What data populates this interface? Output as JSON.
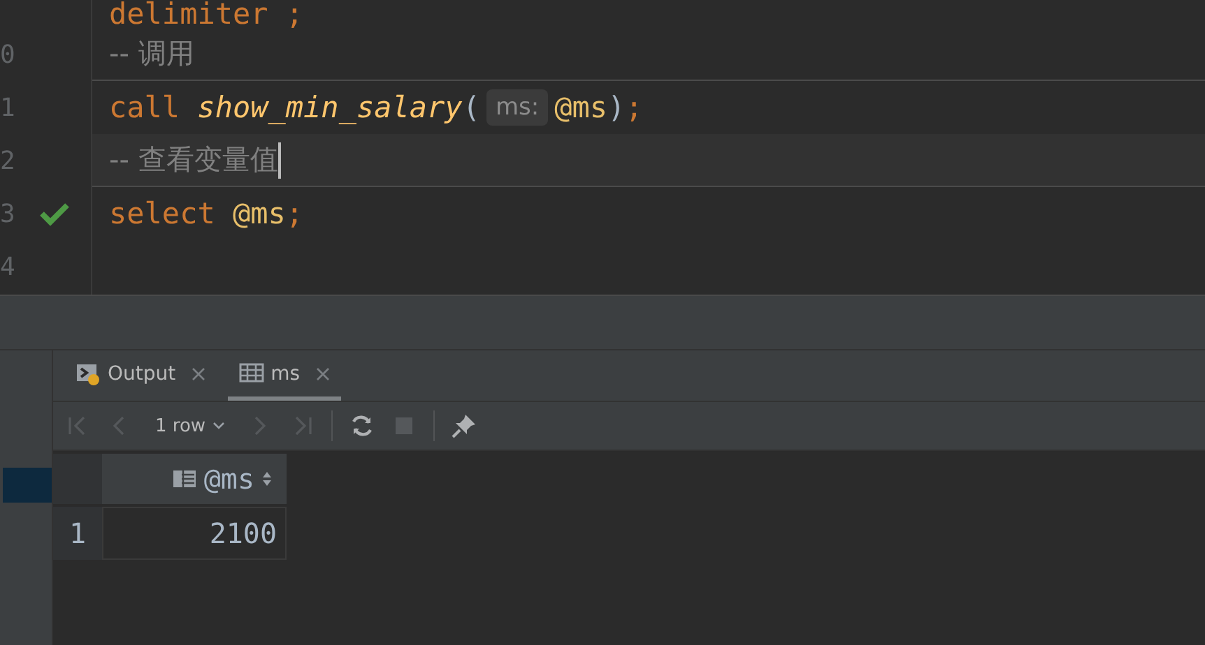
{
  "editor": {
    "lines": [
      {
        "tokens": [
          {
            "kind": "keyword",
            "text": "delimiter ;"
          }
        ]
      },
      {
        "gutter": "0",
        "separator_below": true,
        "tokens": [
          {
            "kind": "comment",
            "text": "-- 调用"
          }
        ]
      },
      {
        "gutter": "1",
        "tokens": [
          {
            "kind": "keyword",
            "text": "call"
          },
          {
            "kind": "function",
            "text": "show_min_salary"
          },
          {
            "kind": "paren",
            "text": "("
          },
          {
            "kind": "hint",
            "text": "ms:"
          },
          {
            "kind": "variable",
            "text": "@ms"
          },
          {
            "kind": "paren",
            "text": ")"
          },
          {
            "kind": "semicolon",
            "text": ";"
          }
        ]
      },
      {
        "gutter": "2",
        "current": true,
        "separator_below": true,
        "tokens": [
          {
            "kind": "comment",
            "text": "-- 查看变量值"
          }
        ]
      },
      {
        "gutter": "3",
        "passed": true,
        "tokens": [
          {
            "kind": "keyword",
            "text": "select"
          },
          {
            "kind": "variable",
            "text": "@ms"
          },
          {
            "kind": "semicolon",
            "text": ";"
          }
        ]
      },
      {
        "gutter": "4"
      }
    ]
  },
  "left_panel": {
    "rows": [
      {
        "selected": true
      }
    ]
  },
  "results": {
    "tabs": [
      {
        "kind": "output",
        "label": "Output",
        "selected": false
      },
      {
        "kind": "table",
        "label": "ms",
        "selected": true
      }
    ],
    "toolbar": [
      {
        "kind": "first",
        "disabled": true
      },
      {
        "kind": "prev",
        "disabled": true
      },
      {
        "kind": "pagesize",
        "label": "1 row"
      },
      {
        "kind": "next",
        "disabled": true
      },
      {
        "kind": "last",
        "disabled": true
      },
      {
        "kind": "separator"
      },
      {
        "kind": "refresh",
        "disabled": false
      },
      {
        "kind": "stop",
        "disabled": true
      },
      {
        "kind": "separator"
      },
      {
        "kind": "pin",
        "disabled": false
      }
    ],
    "grid": {
      "columns": [
        {
          "label": "@ms"
        }
      ],
      "rows": [
        {
          "number": "1",
          "cells": [
            "2100"
          ]
        }
      ]
    }
  }
}
